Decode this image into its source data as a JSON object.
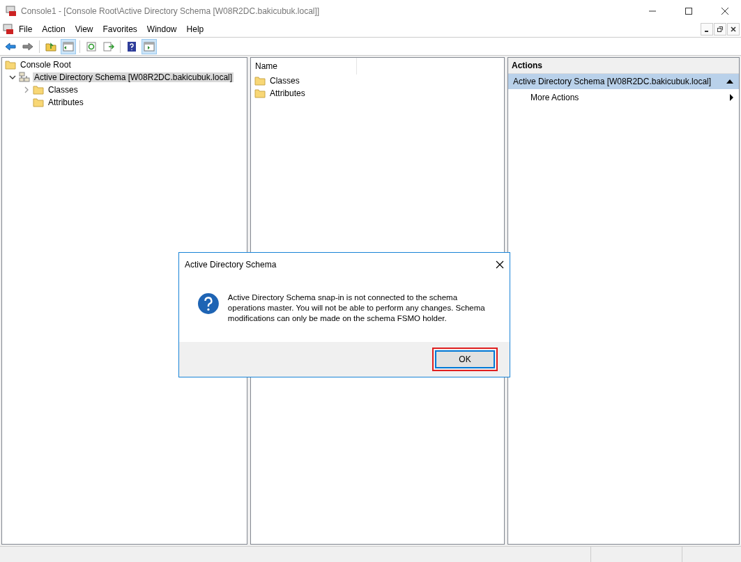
{
  "window": {
    "title": "Console1 - [Console Root\\Active Directory Schema [W08R2DC.bakicubuk.local]]"
  },
  "menu": [
    "File",
    "Action",
    "View",
    "Favorites",
    "Window",
    "Help"
  ],
  "toolbar": {
    "tree_pane_shown": true,
    "action_pane_shown": true
  },
  "tree": [
    {
      "label": "Console Root",
      "selected": false,
      "children": [
        {
          "label": "Active Directory Schema [W08R2DC.bakicubuk.local]",
          "expanded": true,
          "selected": true,
          "children": [
            {
              "label": "Classes",
              "expanded": false,
              "selected": false
            },
            {
              "label": "Attributes",
              "selected": false
            }
          ]
        }
      ]
    }
  ],
  "list": {
    "columns": [
      "Name"
    ],
    "items": [
      "Classes",
      "Attributes"
    ]
  },
  "actions": {
    "title": "Actions",
    "section": {
      "label": "Active Directory Schema [W08R2DC.bakicubuk.local]",
      "expanded": true
    },
    "items": [
      "More Actions"
    ]
  },
  "dialog": {
    "title": "Active Directory Schema",
    "message": "Active Directory Schema snap-in is not connected to the schema operations master. You will not be able to perform any changes. Schema modifications can only be made on the schema FSMO holder.",
    "button": {
      "label": "OK",
      "focused": true,
      "highlighted": true
    }
  }
}
